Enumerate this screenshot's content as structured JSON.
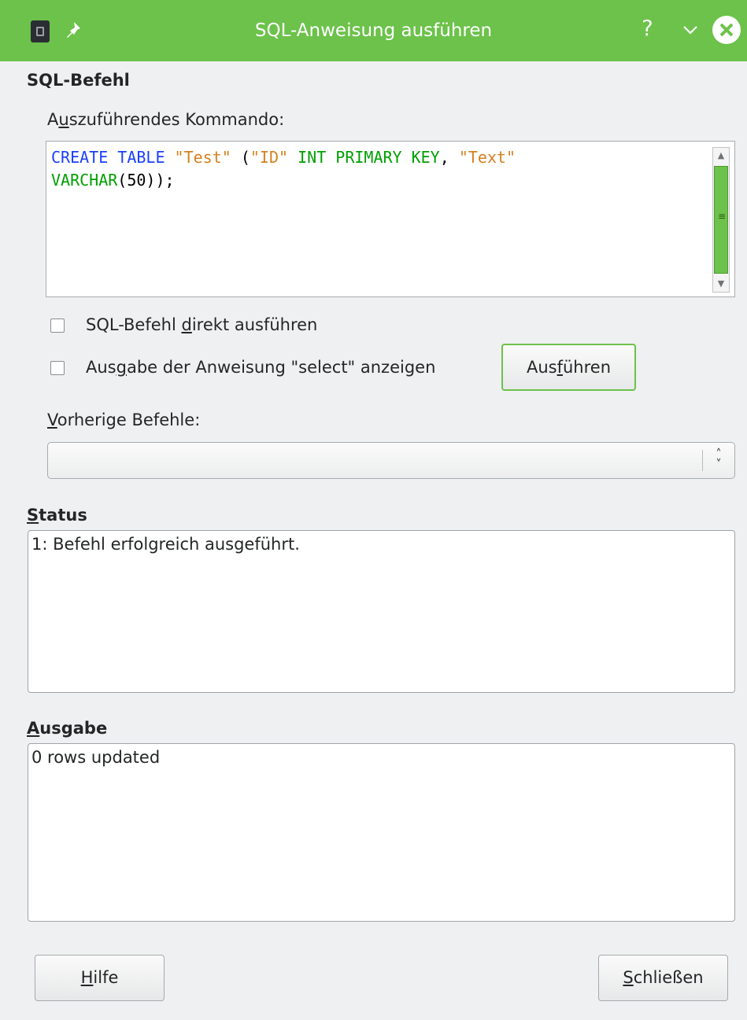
{
  "window": {
    "title": "SQL-Anweisung ausführen",
    "help_glyph": "?",
    "icons": [
      "app-icon",
      "pin-icon",
      "help-icon",
      "minimize-icon",
      "close-icon"
    ],
    "accent_color": "#6cc24a"
  },
  "sql_section": {
    "title": "SQL-Befehl",
    "command_label_pre": "A",
    "command_label_mnemonic": "u",
    "command_label_post": "szuführendes Kommando:",
    "code_line1": {
      "t1": "CREATE TABLE",
      "t2": " ",
      "t3": "\"Test\"",
      "t4": " (",
      "t5": "\"ID\"",
      "t6": " ",
      "t7": "INT PRIMARY KEY",
      "t8": ", ",
      "t9": "\"Text\""
    },
    "code_line2": {
      "t1": "VARCHAR",
      "t2": "(50));"
    }
  },
  "options": {
    "direct_pre": "SQL-Befehl ",
    "direct_mnemonic": "d",
    "direct_post": "irekt ausführen",
    "direct_checked": false,
    "select_pre": "Aus",
    "select_mnemonic": "g",
    "select_post": "abe der Anweisung \"select\" anzeigen",
    "select_checked": false,
    "execute_pre": "Aus",
    "execute_mnemonic": "f",
    "execute_post": "ühren"
  },
  "previous": {
    "label_mnemonic": "V",
    "label_post": "orherige Befehle:",
    "selected_value": ""
  },
  "status": {
    "title_mnemonic": "S",
    "title_post": "tatus",
    "text": "1: Befehl erfolgreich ausgeführt."
  },
  "output": {
    "title_mnemonic": "A",
    "title_post": "usgabe",
    "text": "0 rows updated"
  },
  "footer": {
    "help_mnemonic": "H",
    "help_post": "ilfe",
    "close_mnemonic": "S",
    "close_post": "chließen"
  }
}
